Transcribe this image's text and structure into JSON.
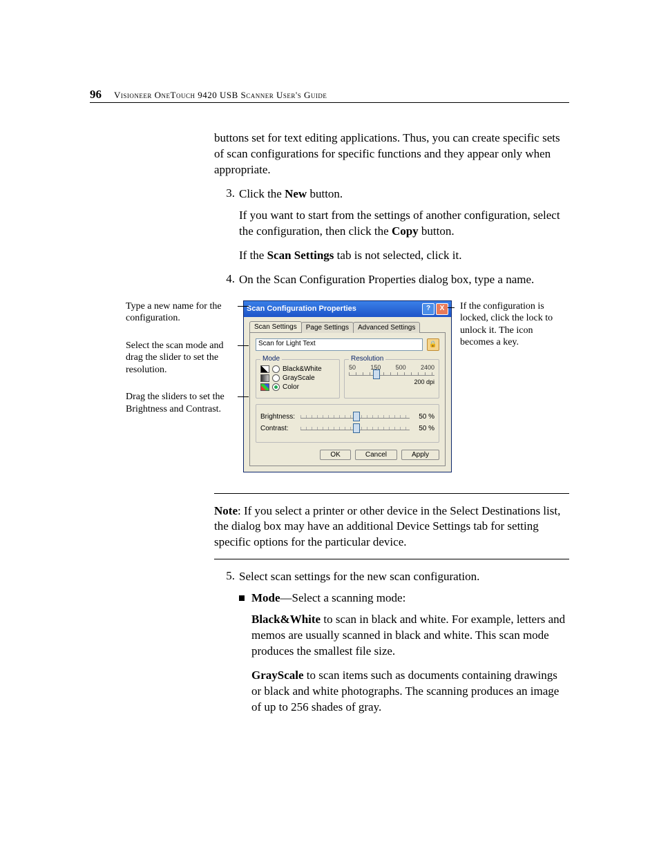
{
  "header": {
    "page_number": "96",
    "title": "Visioneer OneTouch 9420 USB Scanner User's Guide"
  },
  "body": {
    "intro_para": "buttons set for text editing applications. Thus, you can create specific sets of scan configurations for specific functions and they appear only when appropriate.",
    "step3_num": "3.",
    "step3_text_a": "Click the ",
    "step3_bold": "New",
    "step3_text_b": " button.",
    "step3_p1_a": "If you want to start from the settings of another configuration, select the configuration, then click the ",
    "step3_p1_bold": "Copy",
    "step3_p1_b": " button.",
    "step3_p2_a": "If the ",
    "step3_p2_bold": "Scan Settings",
    "step3_p2_b": " tab is not selected, click it.",
    "step4_num": "4.",
    "step4_text": "On the Scan Configuration Properties dialog box, type a name.",
    "step5_num": "5.",
    "step5_text": "Select scan settings for the new scan configuration.",
    "bullet_mode_bold": "Mode",
    "bullet_mode_text": "—Select a scanning mode:",
    "bw_bold": "Black&White",
    "bw_text": " to scan in black and white. For example, letters and memos are usually scanned in black and white. This scan mode produces the smallest file size.",
    "gs_bold": "GrayScale",
    "gs_text": " to scan items such as documents containing drawings or black and white photographs. The scanning produces an image of up to 256 shades of gray."
  },
  "note": {
    "label": "Note",
    "text": ":  If you select a printer or other device in the Select Destinations list, the dialog box may have an additional Device Settings tab for setting specific options for the particular device."
  },
  "callouts": {
    "left1": "Type a new name for the configuration.",
    "left2": "Select the scan mode and drag the slider to set the resolution.",
    "left3": "Drag the sliders to set the Brightness and Contrast.",
    "right1": "If the configuration is locked, click the lock to unlock it. The icon becomes a key."
  },
  "dialog": {
    "title": "Scan Configuration Properties",
    "help_btn": "?",
    "close_btn": "X",
    "tabs": {
      "scan": "Scan Settings",
      "page": "Page Settings",
      "adv": "Advanced Settings"
    },
    "name_value": "Scan for Light Text",
    "mode_legend": "Mode",
    "res_legend": "Resolution",
    "mode_bw": "Black&White",
    "mode_gs": "GrayScale",
    "mode_color": "Color",
    "ticks": {
      "t1": "50",
      "t2": "150",
      "t3": "500",
      "t4": "2400"
    },
    "dpi": "200 dpi",
    "brightness_label": "Brightness:",
    "brightness_val": "50 %",
    "contrast_label": "Contrast:",
    "contrast_val": "50 %",
    "ok": "OK",
    "cancel": "Cancel",
    "apply": "Apply"
  }
}
